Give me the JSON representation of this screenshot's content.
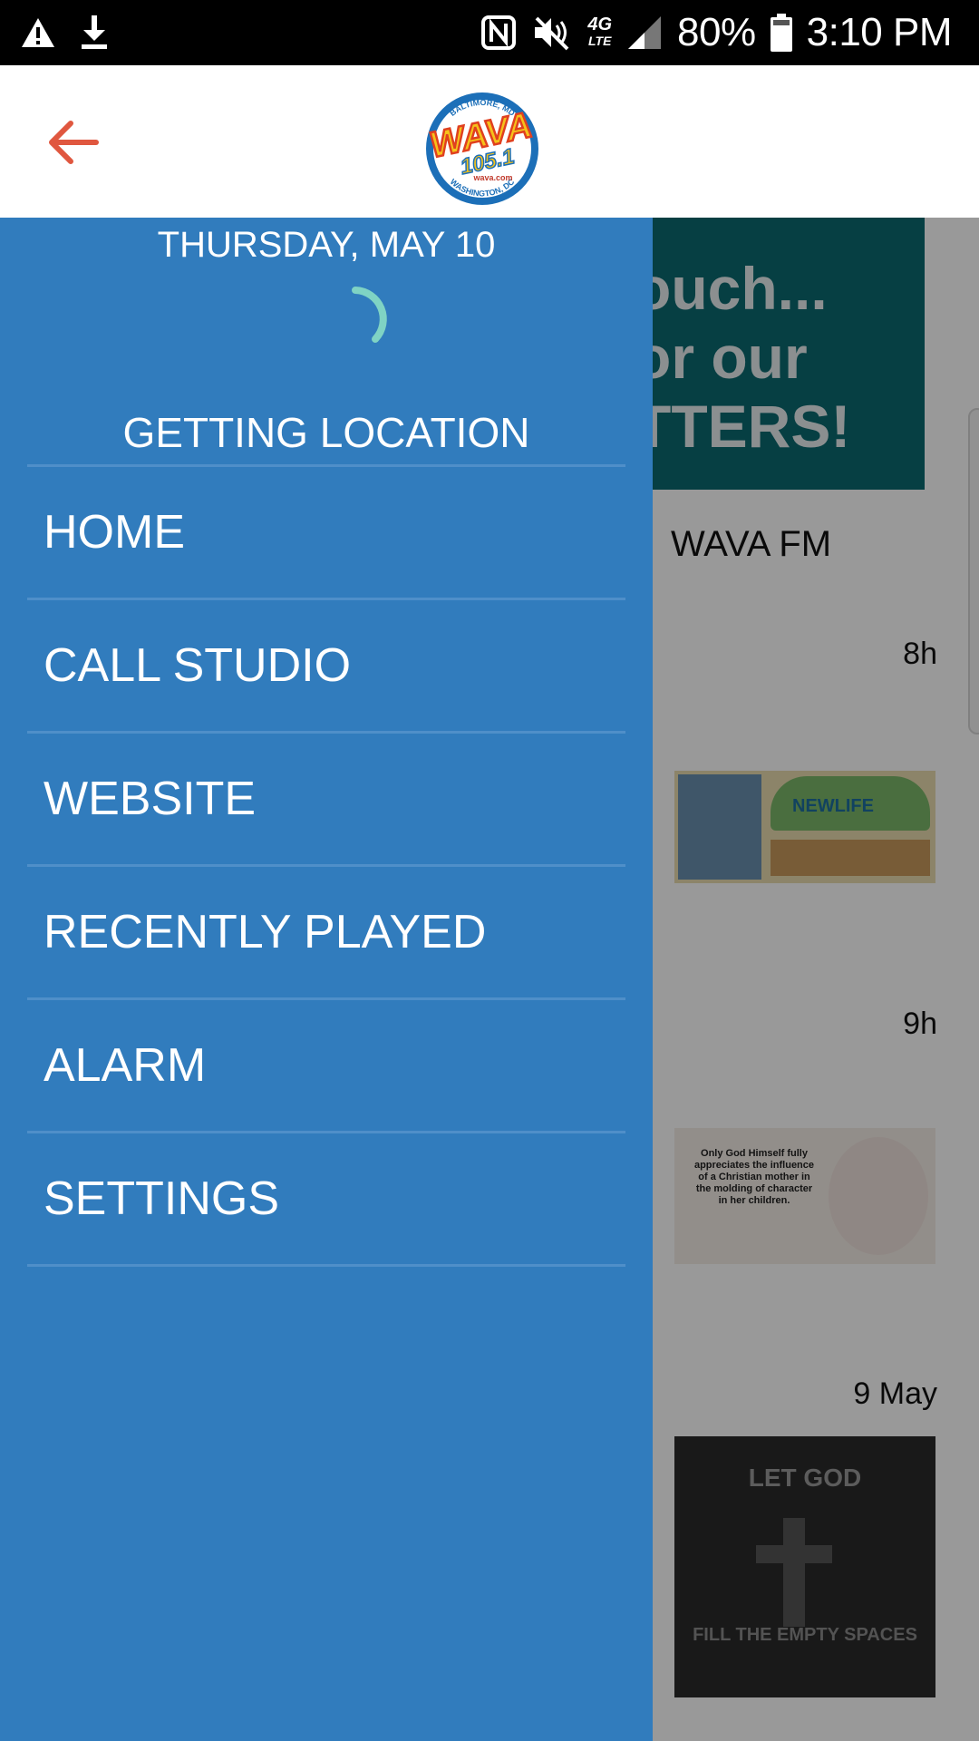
{
  "status_bar": {
    "battery": "80%",
    "time": "3:10 PM",
    "network": "4G",
    "network_sub": "LTE",
    "icons": [
      "warning-icon",
      "download-icon",
      "nfc-icon",
      "mute-icon",
      "signal-icon",
      "battery-icon"
    ]
  },
  "app_bar": {
    "logo": {
      "brand": "WAVA",
      "frequency": "105.1",
      "site": "wava.com",
      "top_arc": "BALTIMORE, MD",
      "bottom_arc": "WASHINGTON, DC"
    },
    "back_icon": "arrow-left-icon",
    "accent_color": "#e0573f"
  },
  "drawer": {
    "date": "THURSDAY, MAY 10",
    "location_status": "GETTING LOCATION",
    "background_color": "#317cbd",
    "spinner_color": "#7fd3c4",
    "menu": [
      {
        "label": "HOME"
      },
      {
        "label": "CALL STUDIO"
      },
      {
        "label": "WEBSITE"
      },
      {
        "label": "RECENTLY PLAYED"
      },
      {
        "label": "ALARM"
      },
      {
        "label": "SETTINGS"
      }
    ]
  },
  "background_content": {
    "banner_lines": [
      "ouch...",
      "or our",
      "TTERS!"
    ],
    "station_name": "WAVA FM",
    "posts": [
      {
        "time": "8h",
        "image_text": "NEWLIFE"
      },
      {
        "time": "9h",
        "image_text": "Only God Himself fully appreciates the influence of a Christian mother in the molding of character in her children."
      },
      {
        "time": "9 May",
        "image_text_top": "LET GOD",
        "image_text_bottom": "FILL THE EMPTY SPACES"
      }
    ]
  }
}
